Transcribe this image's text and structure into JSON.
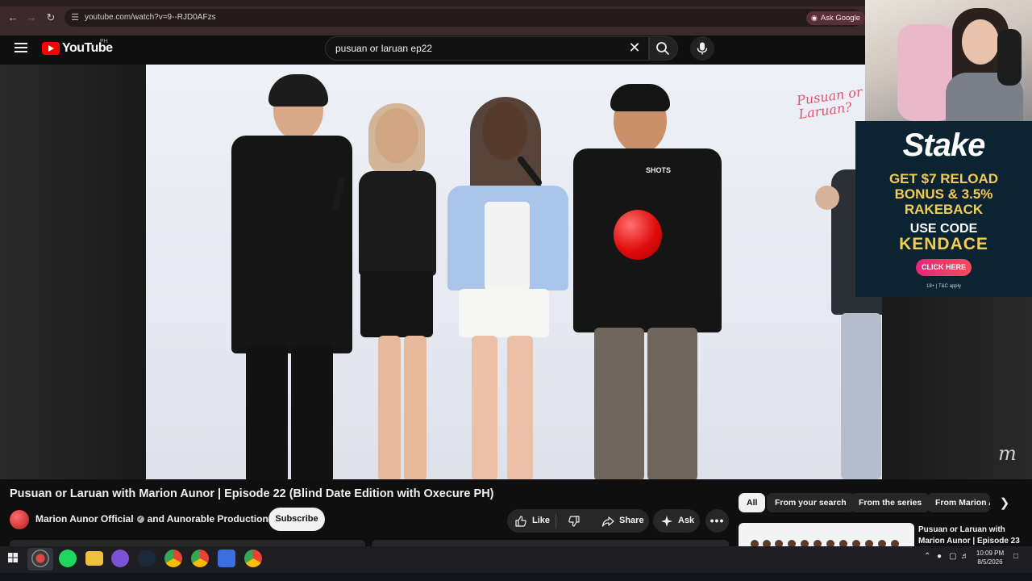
{
  "browser": {
    "url": "youtube.com/watch?v=9--RJD0AFzs",
    "ask_google": "Ask Google"
  },
  "youtube": {
    "logo_text": "YouTube",
    "country_code": "PH",
    "search_query": "pusuan or laruan ep22"
  },
  "video": {
    "scene_logo_text": "Pusuan or Laruan?",
    "balloon_color": "#e00c0c",
    "shirt_text": "SHOTS"
  },
  "ad": {
    "brand": "Stake",
    "line1": "GET $7 RELOAD",
    "line2": "BONUS & 3.5%",
    "line3": "RAKEBACK",
    "use_code": "USE CODE",
    "code": "KENDACE",
    "button": "CLICK HERE",
    "fine_print": "18+ | T&C apply"
  },
  "watch": {
    "title": "Pusuan or Laruan with Marion Aunor | Episode 22 (Blind Date Edition with Oxecure PH)",
    "channel": "Marion Aunor Official",
    "collab": "and Aunorable Productions",
    "subscribe": "Subscribe",
    "like": "Like",
    "share": "Share",
    "ask": "Ask"
  },
  "sidebar": {
    "chips": [
      "All",
      "From your search",
      "From the series",
      "From Marion A"
    ],
    "rec_title": "Pusuan or Laruan with Marion Aunor | Episode 23"
  },
  "taskbar": {
    "time": "10:09 PM",
    "date": "8/5/2026"
  },
  "colors": {
    "yt_red": "#ff0000",
    "stake_gold": "#f2cc55",
    "stake_bg": "#0c2431",
    "browser_frame": "#3a2a2e"
  }
}
